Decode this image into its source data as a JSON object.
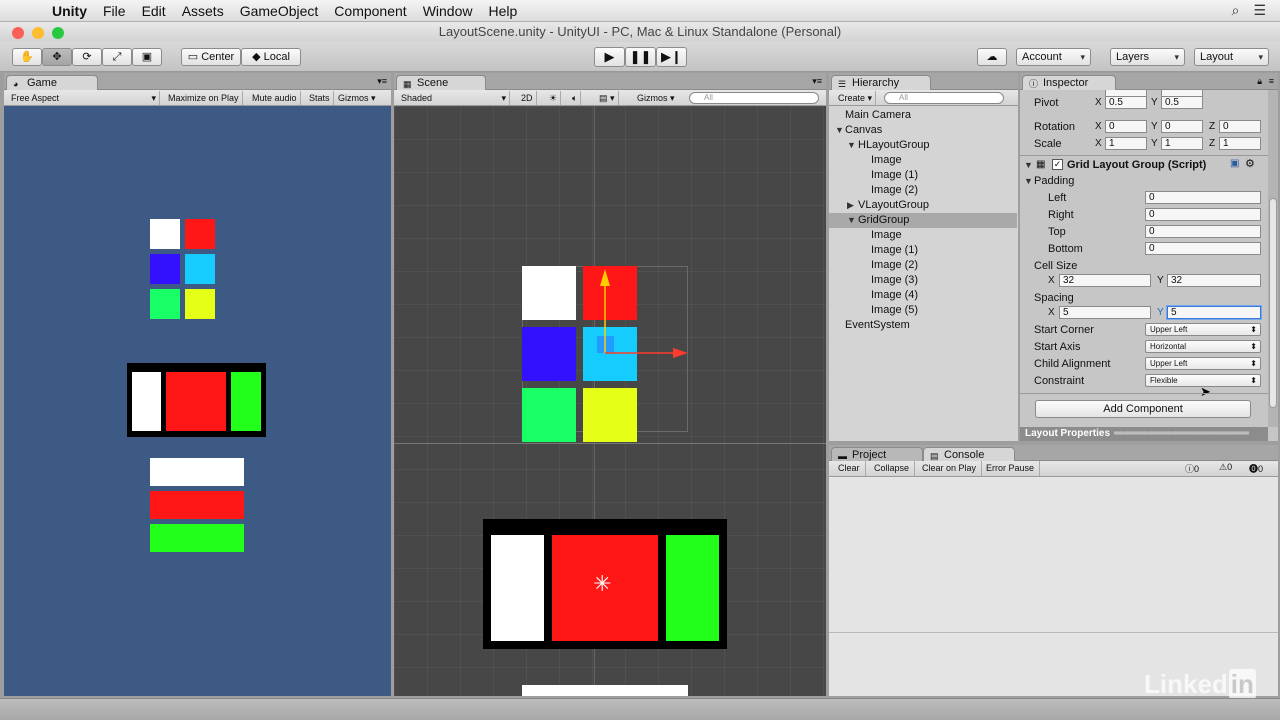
{
  "menubar": {
    "apple": "",
    "app": "Unity",
    "items": [
      "File",
      "Edit",
      "Assets",
      "GameObject",
      "Component",
      "Window",
      "Help"
    ]
  },
  "window": {
    "title": "LayoutScene.unity - UnityUI - PC, Mac & Linux Standalone (Personal)"
  },
  "toolbar": {
    "center": "Center",
    "local": "Local",
    "account": "Account",
    "layers": "Layers",
    "layout": "Layout"
  },
  "game": {
    "tab": "Game",
    "aspect": "Free Aspect",
    "maximize": "Maximize on Play",
    "mute": "Mute audio",
    "stats": "Stats",
    "gizmos": "Gizmos"
  },
  "scene": {
    "tab": "Scene",
    "shading": "Shaded",
    "mode2d": "2D",
    "gizmos": "Gizmos",
    "search_placeholder": "All"
  },
  "hierarchy": {
    "tab": "Hierarchy",
    "create": "Create",
    "search_placeholder": "All",
    "items": [
      "Main Camera",
      "Canvas",
      "HLayoutGroup",
      "Image",
      "Image (1)",
      "Image (2)",
      "VLayoutGroup",
      "GridGroup",
      "Image",
      "Image (1)",
      "Image (2)",
      "Image (3)",
      "Image (4)",
      "Image (5)",
      "EventSystem"
    ]
  },
  "inspector": {
    "tab": "Inspector",
    "pivot": {
      "label": "Pivot",
      "x": "0.5",
      "y": "0.5"
    },
    "rotation": {
      "label": "Rotation",
      "x": "0",
      "y": "0",
      "z": "0"
    },
    "scale": {
      "label": "Scale",
      "x": "1",
      "y": "1",
      "z": "1"
    },
    "component": "Grid Layout Group (Script)",
    "padding": {
      "label": "Padding",
      "left_label": "Left",
      "left": "0",
      "right_label": "Right",
      "right": "0",
      "top_label": "Top",
      "top": "0",
      "bottom_label": "Bottom",
      "bottom": "0"
    },
    "cell_size": {
      "label": "Cell Size",
      "x": "32",
      "y": "32"
    },
    "spacing": {
      "label": "Spacing",
      "x": "5",
      "y": "5"
    },
    "start_corner": {
      "label": "Start Corner",
      "value": "Upper Left"
    },
    "start_axis": {
      "label": "Start Axis",
      "value": "Horizontal"
    },
    "child_alignment": {
      "label": "Child Alignment",
      "value": "Upper Left"
    },
    "constraint": {
      "label": "Constraint",
      "value": "Flexible"
    },
    "add_component": "Add Component",
    "layout_properties": "Layout Properties"
  },
  "console": {
    "project_tab": "Project",
    "console_tab": "Console",
    "clear": "Clear",
    "collapse": "Collapse",
    "clear_on_play": "Clear on Play",
    "error_pause": "Error Pause",
    "info_count": "0",
    "warn_count": "0",
    "error_count": "0"
  },
  "axis_labels": {
    "x": "X",
    "y": "Y",
    "z": "Z"
  },
  "watermark": "Linked",
  "colors": {
    "game_bg": "#3d5a84",
    "scene_bg": "#474747",
    "white": "#ffffff",
    "red": "#ff1616",
    "blue": "#3311ff",
    "cyan": "#16ccff",
    "green": "#19ff66",
    "yellow": "#e6ff16",
    "lime": "#22ff1a"
  }
}
